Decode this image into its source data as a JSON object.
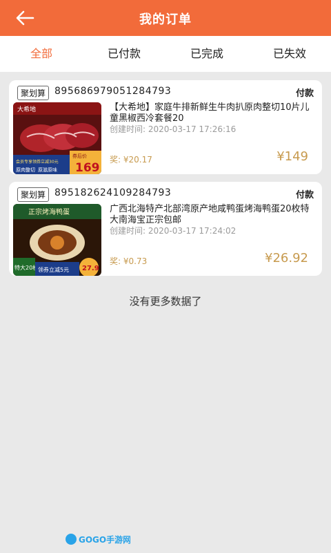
{
  "header": {
    "title": "我的订单"
  },
  "tabs": [
    {
      "label": "全部",
      "active": true
    },
    {
      "label": "已付款",
      "active": false
    },
    {
      "label": "已完成",
      "active": false
    },
    {
      "label": "已失效",
      "active": false
    }
  ],
  "orders": [
    {
      "tag": "聚划算",
      "order_no": "895686979051284793",
      "status": "付款",
      "title": "【大希地】家庭牛排新鲜生牛肉扒原肉整切10片儿童黑椒西冷套餐20",
      "time_label": "创建时间: ",
      "time": "2020-03-17 17:26:16",
      "reward_label": "奖: ",
      "reward": "¥20.17",
      "price": "¥149",
      "image": {
        "brand": "大希地",
        "price_tag": "券后价",
        "price": "169",
        "coupon": "会员专享领券立减30元",
        "badge1": "原肉整切",
        "badge2": "原滋原味"
      }
    },
    {
      "tag": "聚划算",
      "order_no": "895182624109284793",
      "status": "付款",
      "title": "广西北海特产北部湾原产地咸鸭蛋烤海鸭蛋20枚特大南海宝正宗包邮",
      "time_label": "创建时间: ",
      "time": "2020-03-17 17:24:02",
      "reward_label": "奖: ",
      "reward": "¥0.73",
      "price": "¥26.92",
      "image": {
        "banner": "正宗烤海鸭蛋",
        "badge": "特大20枚",
        "coupon": "领券立减5元",
        "price": "27.9"
      }
    }
  ],
  "footer": {
    "no_more": "没有更多数据了"
  },
  "watermark": {
    "text": "GOGO手游网"
  },
  "colors": {
    "accent": "#f26b3a",
    "price": "#c79a4e",
    "muted": "#9a9a9a",
    "background": "#e9e9e9"
  }
}
